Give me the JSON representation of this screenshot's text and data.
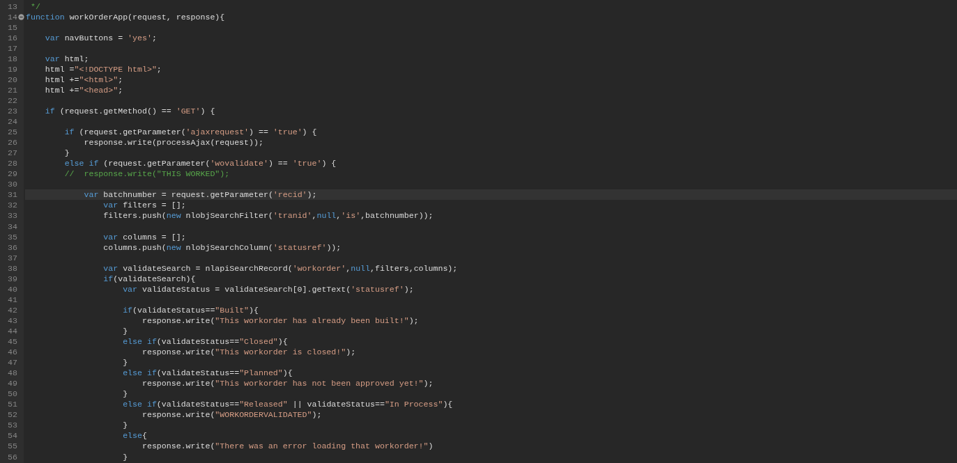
{
  "editor": {
    "lines": [
      {
        "number": "13",
        "current": false,
        "fold": false,
        "tokens": [
          {
            "kind": "comment",
            "text": " */"
          }
        ]
      },
      {
        "number": "14",
        "current": false,
        "fold": true,
        "tokens": [
          {
            "kind": "keyword",
            "text": "function"
          },
          {
            "kind": "plain",
            "text": " workOrderApp(request, response){"
          }
        ]
      },
      {
        "number": "15",
        "current": false,
        "fold": false
      },
      {
        "number": "16",
        "current": false,
        "fold": false,
        "tokens": [
          {
            "kind": "keyword",
            "text": "    var"
          },
          {
            "kind": "plain",
            "text": " navButtons = "
          },
          {
            "kind": "string",
            "text": "'yes'"
          },
          {
            "kind": "plain",
            "text": ";"
          }
        ]
      },
      {
        "number": "17",
        "current": false,
        "fold": false
      },
      {
        "number": "18",
        "current": false,
        "fold": false,
        "tokens": [
          {
            "kind": "keyword",
            "text": "    var"
          },
          {
            "kind": "plain",
            "text": " html;"
          }
        ]
      },
      {
        "number": "19",
        "current": false,
        "fold": false,
        "tokens": [
          {
            "kind": "plain",
            "text": "    html ="
          },
          {
            "kind": "string",
            "text": "\"<!DOCTYPE html>\""
          },
          {
            "kind": "plain",
            "text": ";"
          }
        ]
      },
      {
        "number": "20",
        "current": false,
        "fold": false,
        "tokens": [
          {
            "kind": "plain",
            "text": "    html +="
          },
          {
            "kind": "string",
            "text": "\"<html>\""
          },
          {
            "kind": "plain",
            "text": ";"
          }
        ]
      },
      {
        "number": "21",
        "current": false,
        "fold": false,
        "tokens": [
          {
            "kind": "plain",
            "text": "    html +="
          },
          {
            "kind": "string",
            "text": "\"<head>\""
          },
          {
            "kind": "plain",
            "text": ";"
          }
        ]
      },
      {
        "number": "22",
        "current": false,
        "fold": false
      },
      {
        "number": "23",
        "current": false,
        "fold": false,
        "tokens": [
          {
            "kind": "keyword",
            "text": "    if"
          },
          {
            "kind": "plain",
            "text": " (request.getMethod() == "
          },
          {
            "kind": "string",
            "text": "'GET'"
          },
          {
            "kind": "plain",
            "text": ") {"
          }
        ]
      },
      {
        "number": "24",
        "current": false,
        "fold": false
      },
      {
        "number": "25",
        "current": false,
        "fold": false,
        "tokens": [
          {
            "kind": "keyword",
            "text": "        if"
          },
          {
            "kind": "plain",
            "text": " (request.getParameter("
          },
          {
            "kind": "string",
            "text": "'ajaxrequest'"
          },
          {
            "kind": "plain",
            "text": ") == "
          },
          {
            "kind": "string",
            "text": "'true'"
          },
          {
            "kind": "plain",
            "text": ") {"
          }
        ]
      },
      {
        "number": "26",
        "current": false,
        "fold": false,
        "tokens": [
          {
            "kind": "plain",
            "text": "            response.write(processAjax(request));"
          }
        ]
      },
      {
        "number": "27",
        "current": false,
        "fold": false,
        "tokens": [
          {
            "kind": "plain",
            "text": "        }"
          }
        ]
      },
      {
        "number": "28",
        "current": false,
        "fold": false,
        "tokens": [
          {
            "kind": "keyword",
            "text": "        else if"
          },
          {
            "kind": "plain",
            "text": " (request.getParameter("
          },
          {
            "kind": "string",
            "text": "'wovalidate'"
          },
          {
            "kind": "plain",
            "text": ") == "
          },
          {
            "kind": "string",
            "text": "'true'"
          },
          {
            "kind": "plain",
            "text": ") {"
          }
        ]
      },
      {
        "number": "29",
        "current": false,
        "fold": false,
        "tokens": [
          {
            "kind": "comment",
            "text": "        //  response.write(\"THIS WORKED\");"
          }
        ]
      },
      {
        "number": "30",
        "current": false,
        "fold": false
      },
      {
        "number": "31",
        "current": true,
        "fold": false,
        "tokens": [
          {
            "kind": "keyword",
            "text": "            var"
          },
          {
            "kind": "plain",
            "text": " batchnumber = request.getParameter("
          },
          {
            "kind": "string",
            "text": "'recid'"
          },
          {
            "kind": "plain",
            "text": ");"
          }
        ]
      },
      {
        "number": "32",
        "current": false,
        "fold": false,
        "tokens": [
          {
            "kind": "keyword",
            "text": "                var"
          },
          {
            "kind": "plain",
            "text": " filters = [];"
          }
        ]
      },
      {
        "number": "33",
        "current": false,
        "fold": false,
        "tokens": [
          {
            "kind": "plain",
            "text": "                filters.push("
          },
          {
            "kind": "keyword",
            "text": "new"
          },
          {
            "kind": "plain",
            "text": " nlobjSearchFilter("
          },
          {
            "kind": "string",
            "text": "'tranid'"
          },
          {
            "kind": "plain",
            "text": ","
          },
          {
            "kind": "keyword",
            "text": "null"
          },
          {
            "kind": "plain",
            "text": ","
          },
          {
            "kind": "string",
            "text": "'is'"
          },
          {
            "kind": "plain",
            "text": ",batchnumber));"
          }
        ]
      },
      {
        "number": "34",
        "current": false,
        "fold": false
      },
      {
        "number": "35",
        "current": false,
        "fold": false,
        "tokens": [
          {
            "kind": "keyword",
            "text": "                var"
          },
          {
            "kind": "plain",
            "text": " columns = [];"
          }
        ]
      },
      {
        "number": "36",
        "current": false,
        "fold": false,
        "tokens": [
          {
            "kind": "plain",
            "text": "                columns.push("
          },
          {
            "kind": "keyword",
            "text": "new"
          },
          {
            "kind": "plain",
            "text": " nlobjSearchColumn("
          },
          {
            "kind": "string",
            "text": "'statusref'"
          },
          {
            "kind": "plain",
            "text": "));"
          }
        ]
      },
      {
        "number": "37",
        "current": false,
        "fold": false
      },
      {
        "number": "38",
        "current": false,
        "fold": false,
        "tokens": [
          {
            "kind": "keyword",
            "text": "                var"
          },
          {
            "kind": "plain",
            "text": " validateSearch = nlapiSearchRecord("
          },
          {
            "kind": "string",
            "text": "'workorder'"
          },
          {
            "kind": "plain",
            "text": ","
          },
          {
            "kind": "keyword",
            "text": "null"
          },
          {
            "kind": "plain",
            "text": ",filters,columns);"
          }
        ]
      },
      {
        "number": "39",
        "current": false,
        "fold": false,
        "tokens": [
          {
            "kind": "keyword",
            "text": "                if"
          },
          {
            "kind": "plain",
            "text": "(validateSearch){"
          }
        ]
      },
      {
        "number": "40",
        "current": false,
        "fold": false,
        "tokens": [
          {
            "kind": "keyword",
            "text": "                    var"
          },
          {
            "kind": "plain",
            "text": " validateStatus = validateSearch[0].getText("
          },
          {
            "kind": "string",
            "text": "'statusref'"
          },
          {
            "kind": "plain",
            "text": ");"
          }
        ]
      },
      {
        "number": "41",
        "current": false,
        "fold": false
      },
      {
        "number": "42",
        "current": false,
        "fold": false,
        "tokens": [
          {
            "kind": "keyword",
            "text": "                    if"
          },
          {
            "kind": "plain",
            "text": "(validateStatus=="
          },
          {
            "kind": "string",
            "text": "\"Built\""
          },
          {
            "kind": "plain",
            "text": "){"
          }
        ]
      },
      {
        "number": "43",
        "current": false,
        "fold": false,
        "tokens": [
          {
            "kind": "plain",
            "text": "                        response.write("
          },
          {
            "kind": "string",
            "text": "\"This workorder has already been built!\""
          },
          {
            "kind": "plain",
            "text": ");"
          }
        ]
      },
      {
        "number": "44",
        "current": false,
        "fold": false,
        "tokens": [
          {
            "kind": "plain",
            "text": "                    }"
          }
        ]
      },
      {
        "number": "45",
        "current": false,
        "fold": false,
        "tokens": [
          {
            "kind": "keyword",
            "text": "                    else if"
          },
          {
            "kind": "plain",
            "text": "(validateStatus=="
          },
          {
            "kind": "string",
            "text": "\"Closed\""
          },
          {
            "kind": "plain",
            "text": "){"
          }
        ]
      },
      {
        "number": "46",
        "current": false,
        "fold": false,
        "tokens": [
          {
            "kind": "plain",
            "text": "                        response.write("
          },
          {
            "kind": "string",
            "text": "\"This workorder is closed!\""
          },
          {
            "kind": "plain",
            "text": ");"
          }
        ]
      },
      {
        "number": "47",
        "current": false,
        "fold": false,
        "tokens": [
          {
            "kind": "plain",
            "text": "                    }"
          }
        ]
      },
      {
        "number": "48",
        "current": false,
        "fold": false,
        "tokens": [
          {
            "kind": "keyword",
            "text": "                    else if"
          },
          {
            "kind": "plain",
            "text": "(validateStatus=="
          },
          {
            "kind": "string",
            "text": "\"Planned\""
          },
          {
            "kind": "plain",
            "text": "){"
          }
        ]
      },
      {
        "number": "49",
        "current": false,
        "fold": false,
        "tokens": [
          {
            "kind": "plain",
            "text": "                        response.write("
          },
          {
            "kind": "string",
            "text": "\"This workorder has not been approved yet!\""
          },
          {
            "kind": "plain",
            "text": ");"
          }
        ]
      },
      {
        "number": "50",
        "current": false,
        "fold": false,
        "tokens": [
          {
            "kind": "plain",
            "text": "                    }"
          }
        ]
      },
      {
        "number": "51",
        "current": false,
        "fold": false,
        "tokens": [
          {
            "kind": "keyword",
            "text": "                    else if"
          },
          {
            "kind": "plain",
            "text": "(validateStatus=="
          },
          {
            "kind": "string",
            "text": "\"Released\""
          },
          {
            "kind": "plain",
            "text": " || validateStatus=="
          },
          {
            "kind": "string",
            "text": "\"In Process\""
          },
          {
            "kind": "plain",
            "text": "){"
          }
        ]
      },
      {
        "number": "52",
        "current": false,
        "fold": false,
        "tokens": [
          {
            "kind": "plain",
            "text": "                        response.write("
          },
          {
            "kind": "string",
            "text": "\"WORKORDERVALIDATED\""
          },
          {
            "kind": "plain",
            "text": ");"
          }
        ]
      },
      {
        "number": "53",
        "current": false,
        "fold": false,
        "tokens": [
          {
            "kind": "plain",
            "text": "                    }"
          }
        ]
      },
      {
        "number": "54",
        "current": false,
        "fold": false,
        "tokens": [
          {
            "kind": "keyword",
            "text": "                    else"
          },
          {
            "kind": "plain",
            "text": "{"
          }
        ]
      },
      {
        "number": "55",
        "current": false,
        "fold": false,
        "tokens": [
          {
            "kind": "plain",
            "text": "                        response.write("
          },
          {
            "kind": "string",
            "text": "\"There was an error loading that workorder!\""
          },
          {
            "kind": "plain",
            "text": ")"
          }
        ]
      },
      {
        "number": "56",
        "current": false,
        "fold": false,
        "tokens": [
          {
            "kind": "plain",
            "text": "                    }"
          }
        ]
      }
    ]
  }
}
